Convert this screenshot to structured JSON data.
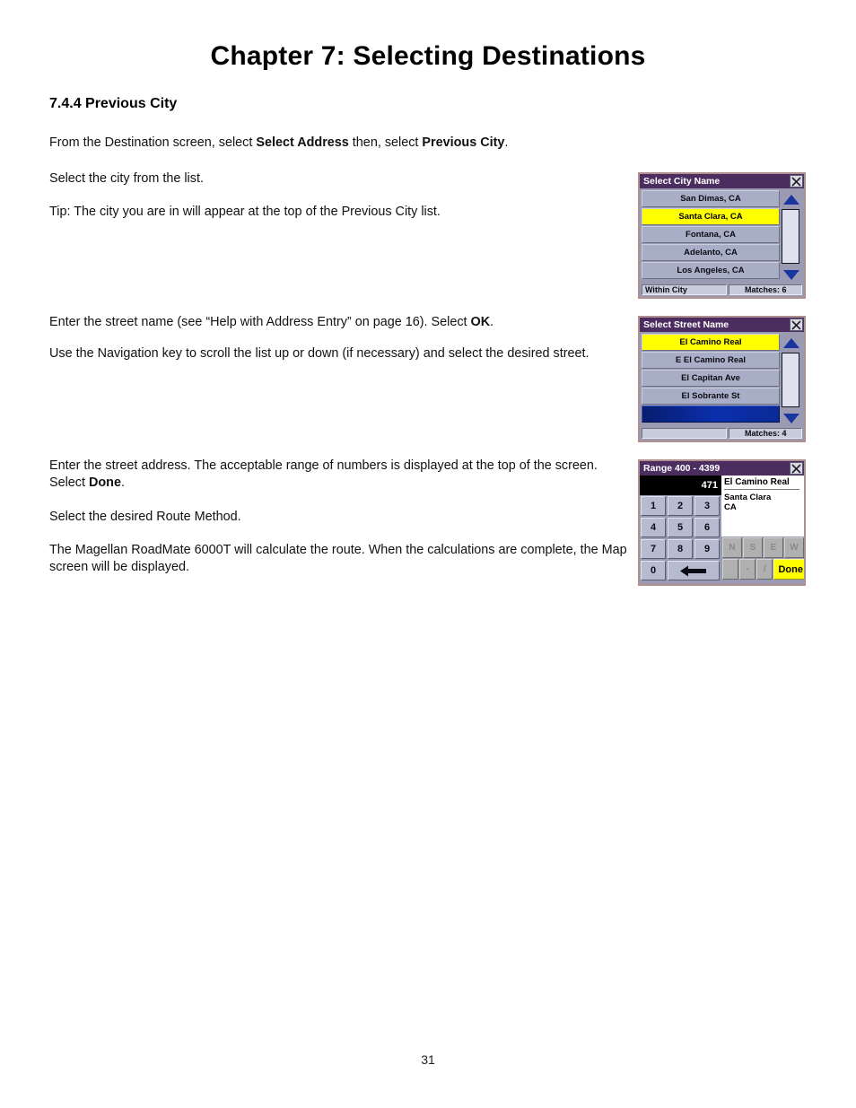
{
  "document": {
    "chapter_title": "Chapter 7: Selecting Destinations",
    "section_heading": "7.4.4 Previous City",
    "page_number": "31"
  },
  "paragraphs": {
    "intro_a": "From the Destination screen, select ",
    "intro_b": "Select Address",
    "intro_c": " then, select ",
    "intro_d": "Previous City",
    "intro_e": ".",
    "select_city": "Select the city from the list.",
    "tip": "Tip:  The city you are in will appear at the top of the Previous City list.",
    "street_a": "Enter the street name (see “Help with Address Entry” on page 16). Select ",
    "street_b": "OK",
    "street_c": ".",
    "navigation": "Use the Navigation key to scroll the list up or down (if necessary) and select the desired street.",
    "address_a": "Enter the street address. The acceptable range of numbers is displayed at the top of the screen. Select ",
    "address_b": "Done",
    "address_c": ".",
    "route_method": "Select the desired Route Method.",
    "calculate": "The Magellan RoadMate 6000T will calculate the route. When the calculations are complete, the Map screen will be displayed."
  },
  "screens": {
    "city": {
      "title": "Select City Name",
      "items": [
        {
          "label": "San Dimas, CA",
          "selected": false
        },
        {
          "label": "Santa Clara, CA",
          "selected": true
        },
        {
          "label": "Fontana, CA",
          "selected": false
        },
        {
          "label": "Adelanto, CA",
          "selected": false
        },
        {
          "label": "Los Angeles, CA",
          "selected": false
        }
      ],
      "status_left": "Within City",
      "status_right": "Matches:  6"
    },
    "street": {
      "title": "Select Street Name",
      "items": [
        {
          "label": "El Camino Real",
          "selected": true
        },
        {
          "label": "E El Camino Real",
          "selected": false
        },
        {
          "label": "El Capitan Ave",
          "selected": false
        },
        {
          "label": "El Sobrante St",
          "selected": false
        }
      ],
      "status_left": "",
      "status_right": "Matches:  4"
    },
    "range": {
      "title": "Range 400 - 4399",
      "entry_value": "471",
      "info_street": "El Camino Real",
      "info_city": "Santa Clara",
      "info_state": "CA",
      "keys": [
        [
          "1",
          "2",
          "3"
        ],
        [
          "4",
          "5",
          "6"
        ],
        [
          "7",
          "8",
          "9"
        ]
      ],
      "key_zero": "0",
      "key_backspace": "backspace-icon",
      "dir_keys": [
        "N",
        "S",
        "E",
        "W"
      ],
      "symbol_keys": [
        "-",
        "/"
      ],
      "done_label": "Done"
    }
  },
  "colors": {
    "titlebar": "#4b2d60",
    "highlight": "#ffff00",
    "list_item": "#a8aec6",
    "scroll_arrow": "#1b35a0",
    "blue_bar": "#0b2fae",
    "bezel": "#b08f8f"
  }
}
